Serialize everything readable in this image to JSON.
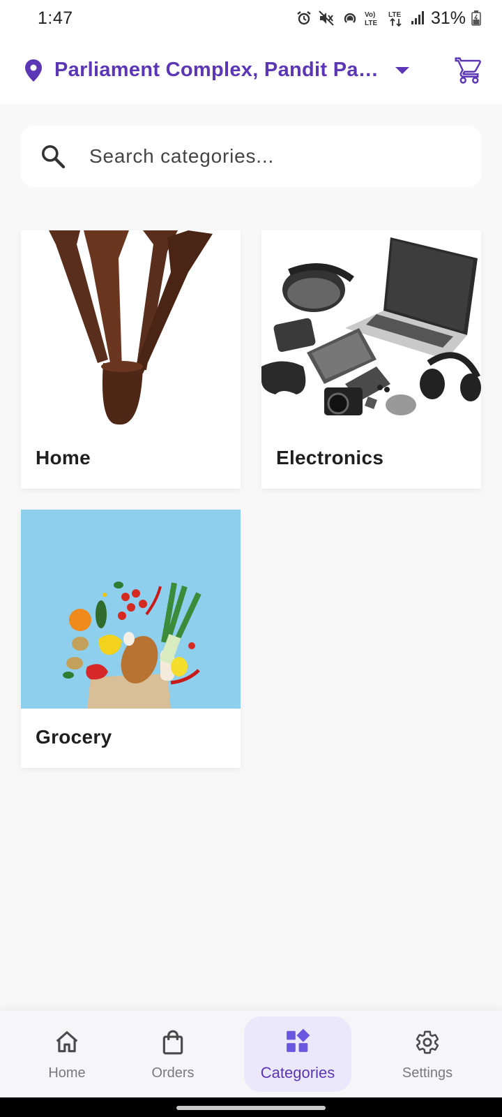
{
  "status_bar": {
    "time": "1:47",
    "volte_label": "Vo) LTE",
    "lte_label": "LTE",
    "battery": "31%"
  },
  "app_bar": {
    "location": "Parliament Complex, Pandit Pant Marg",
    "accent_color": "#5b36b5"
  },
  "search": {
    "placeholder": "Search categories..."
  },
  "categories": [
    {
      "label": "Home"
    },
    {
      "label": "Electronics"
    },
    {
      "label": "Grocery"
    }
  ],
  "bottom_nav": {
    "items": [
      {
        "label": "Home",
        "icon": "home-icon"
      },
      {
        "label": "Orders",
        "icon": "shopping-bag-icon"
      },
      {
        "label": "Categories",
        "icon": "categories-icon",
        "active": true
      },
      {
        "label": "Settings",
        "icon": "gear-icon"
      }
    ]
  }
}
